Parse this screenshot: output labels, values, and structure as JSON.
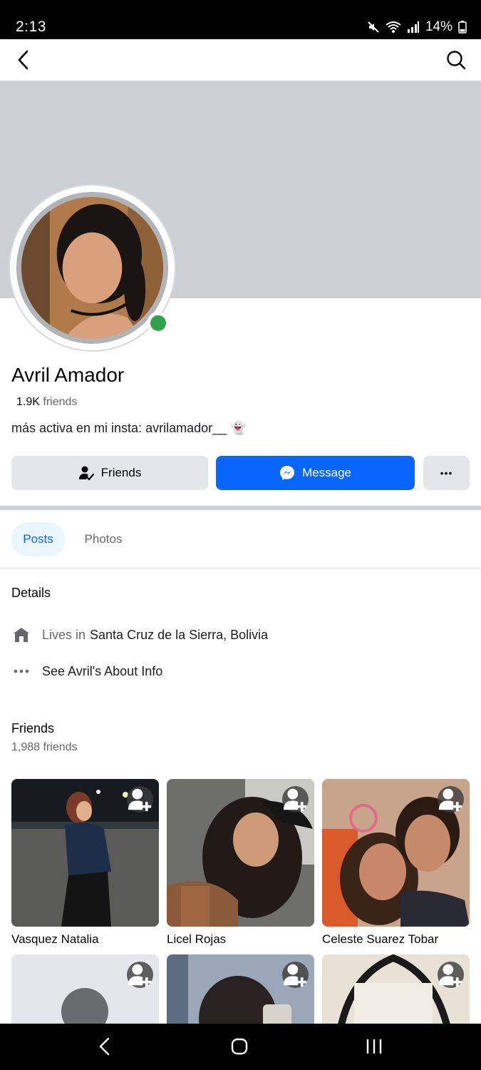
{
  "status_bar": {
    "time": "2:13",
    "battery": "14%"
  },
  "profile": {
    "name": "Avril Amador",
    "friend_count_num": "1.9K",
    "friend_count_label": "friends",
    "bio": "más activa en mi insta: avrilamador__ 👻"
  },
  "actions": {
    "friends_label": "Friends",
    "message_label": "Message",
    "more_label": "•••"
  },
  "tabs": [
    {
      "label": "Posts",
      "selected": true
    },
    {
      "label": "Photos",
      "selected": false
    }
  ],
  "details": {
    "title": "Details",
    "lives_prefix": "Lives in",
    "lives_place": "Santa Cruz de la Sierra, Bolivia",
    "about_link": "See Avril's About Info"
  },
  "friends": {
    "title": "Friends",
    "subtitle": "1,988 friends",
    "items": [
      {
        "name": "Vasquez Natalia"
      },
      {
        "name": "Licel Rojas"
      },
      {
        "name": "Celeste Suarez Tobar"
      },
      {
        "name": ""
      },
      {
        "name": ""
      },
      {
        "name": ""
      }
    ]
  },
  "colors": {
    "accent": "#0866ff",
    "online": "#31a24c",
    "cover": "#ccd0d5",
    "button_gray": "#e4e6eb"
  },
  "icons": [
    "back-arrow-icon",
    "search-icon",
    "person-check-icon",
    "messenger-icon",
    "home-icon",
    "more-dots-icon",
    "add-friend-icon"
  ]
}
